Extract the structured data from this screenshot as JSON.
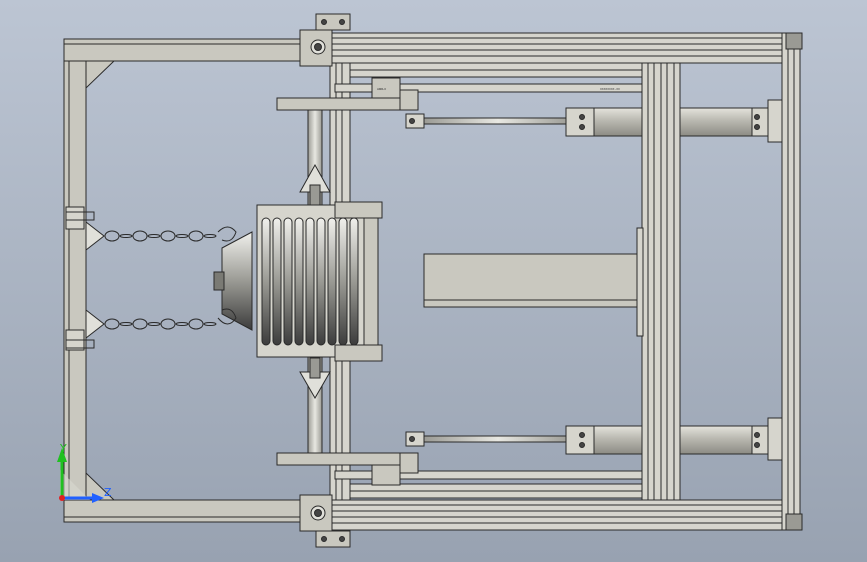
{
  "viewport": {
    "background_top": "#bcc5d3",
    "background_bottom": "#98a2b1"
  },
  "colors": {
    "frame_fill": "#c9c8bf",
    "frame_stroke": "#2a2a2a",
    "rail_fill": "#d6d5cd",
    "cylinder_fill": "#bdbcb4",
    "dark_fill": "#5a5a5a",
    "axis_x": "#2060ff",
    "axis_y": "#20c020",
    "axis_origin": "#e02020"
  },
  "labels": {
    "rail_tag_top": "ANDLO",
    "rail_tag_right": "XXXXXXXX-XX"
  },
  "triad": {
    "y_label": "Y",
    "z_label": "Z"
  },
  "icons": {
    "axis_triad": "axis-triad-icon"
  }
}
